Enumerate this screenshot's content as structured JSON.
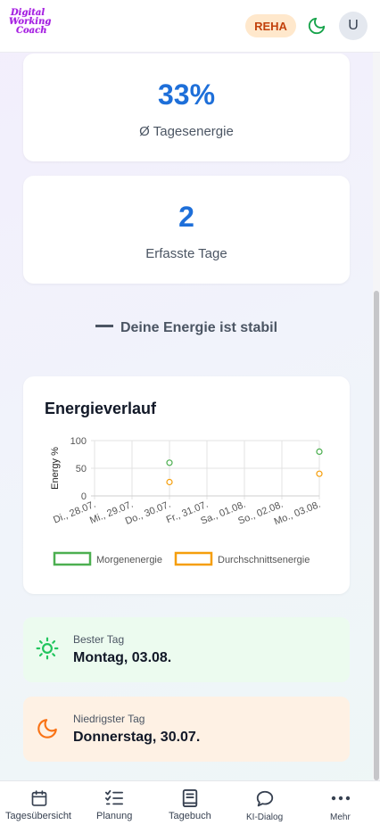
{
  "header": {
    "logo_lines": [
      "Digital",
      "Working",
      "Coach"
    ],
    "badge": "REHA",
    "avatar_initial": "U"
  },
  "stats": [
    {
      "value": "33%",
      "label": "Ø Tagesenergie"
    },
    {
      "value": "2",
      "label": "Erfasste Tage"
    }
  ],
  "trend_text": "Deine Energie ist stabil",
  "chart": {
    "title": "Energieverlauf"
  },
  "chart_data": {
    "type": "scatter",
    "categories": [
      "Di., 28.07.",
      "Mi., 29.07.",
      "Do., 30.07.",
      "Fr., 31.07.",
      "Sa., 01.08.",
      "So., 02.08.",
      "Mo., 03.08."
    ],
    "ylabel": "Energy %",
    "ylim": [
      0,
      100
    ],
    "yticks": [
      0,
      50,
      100
    ],
    "grid": true,
    "legend_position": "bottom",
    "series": [
      {
        "name": "Morgenenergie",
        "color": "#4caf50",
        "values": [
          null,
          null,
          60,
          null,
          null,
          null,
          80
        ]
      },
      {
        "name": "Durchschnittsenergie",
        "color": "#f59e0b",
        "values": [
          null,
          null,
          25,
          null,
          null,
          null,
          40
        ]
      }
    ]
  },
  "best_day": {
    "label": "Bester Tag",
    "value": "Montag, 03.08.",
    "icon": "sun-icon",
    "bg": "#ecfbef"
  },
  "worst_day": {
    "label": "Niedrigster Tag",
    "value": "Donnerstag, 30.07.",
    "icon": "moon-icon",
    "bg": "#fef1e4"
  },
  "nav": [
    {
      "label": "Tagesübersicht",
      "icon": "calendar-icon"
    },
    {
      "label": "Planung",
      "icon": "checklist-icon"
    },
    {
      "label": "Tagebuch",
      "icon": "book-icon"
    },
    {
      "label": "KI-Dialog",
      "icon": "chat-icon"
    },
    {
      "label": "Mehr",
      "icon": "more-icon"
    }
  ],
  "colors": {
    "accent": "#1e6fd9",
    "badge_bg": "#ffe8cc",
    "badge_text": "#c2410c"
  }
}
